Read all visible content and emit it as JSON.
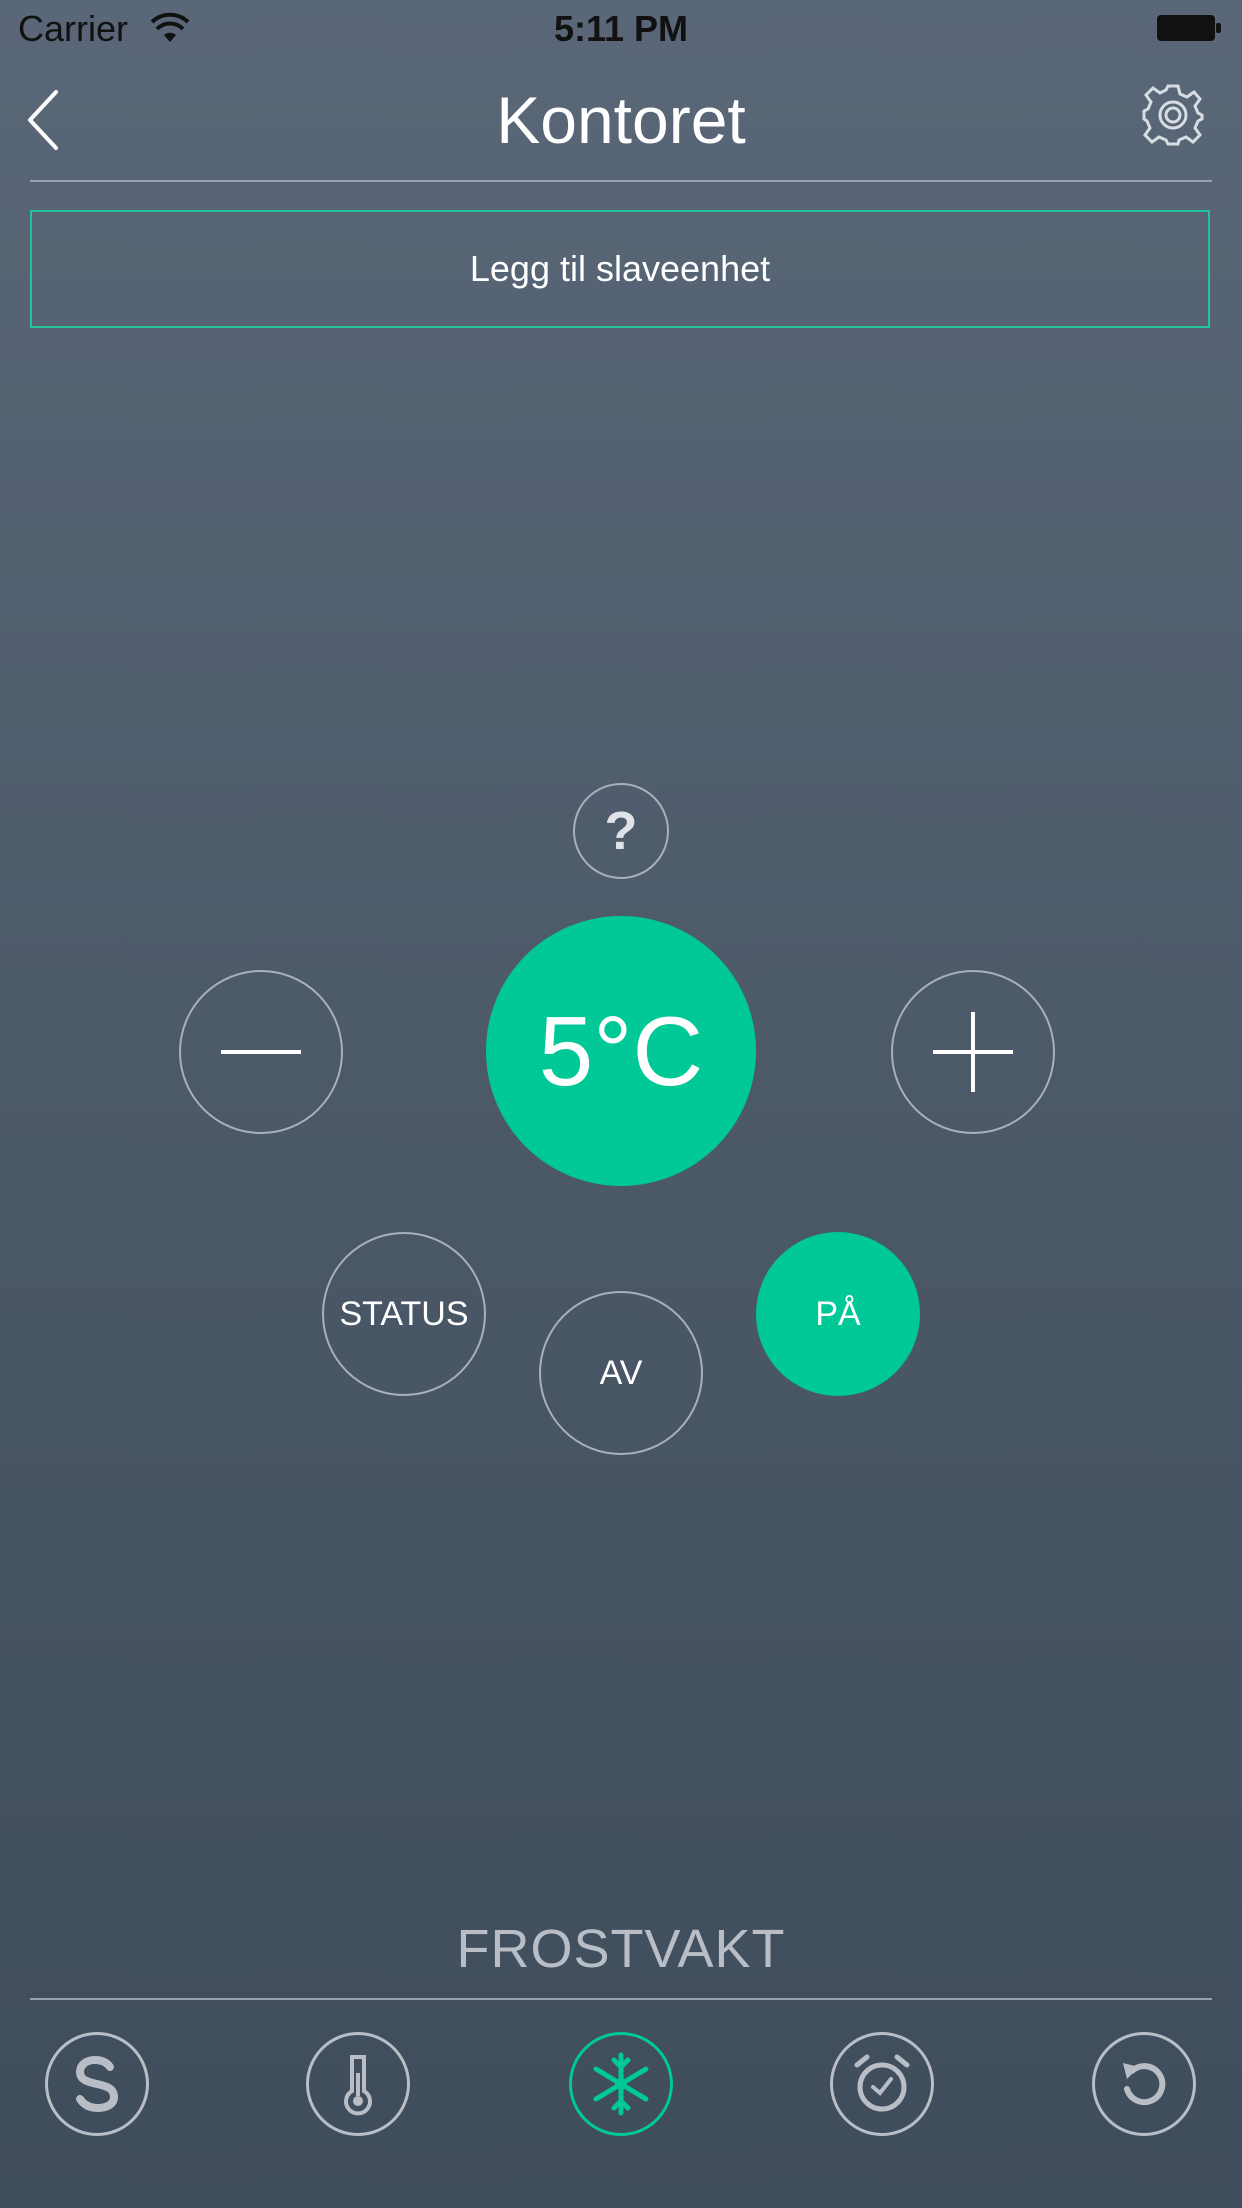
{
  "status_bar": {
    "carrier": "Carrier",
    "time": "5:11 PM"
  },
  "header": {
    "title": "Kontoret",
    "back_icon": "chevron-left-icon",
    "settings_icon": "gear-icon"
  },
  "add_slave": {
    "label": "Legg til slaveenhet"
  },
  "controls": {
    "help_label": "?",
    "temperature": "5°C",
    "decrease_icon": "minus-icon",
    "increase_icon": "plus-icon",
    "status_label": "STATUS",
    "off_label": "AV",
    "on_label": "PÅ"
  },
  "mode": {
    "label": "FROSTVAKT"
  },
  "tabs": [
    {
      "icon": "s-icon",
      "active": false
    },
    {
      "icon": "thermometer-icon",
      "active": false
    },
    {
      "icon": "snowflake-icon",
      "active": true
    },
    {
      "icon": "alarm-clock-icon",
      "active": false
    },
    {
      "icon": "refresh-icon",
      "active": false
    }
  ],
  "colors": {
    "accent": "#00c896",
    "outline": "#a9b0ba",
    "background_top": "#5a6778",
    "background_bottom": "#3f4c5b"
  }
}
